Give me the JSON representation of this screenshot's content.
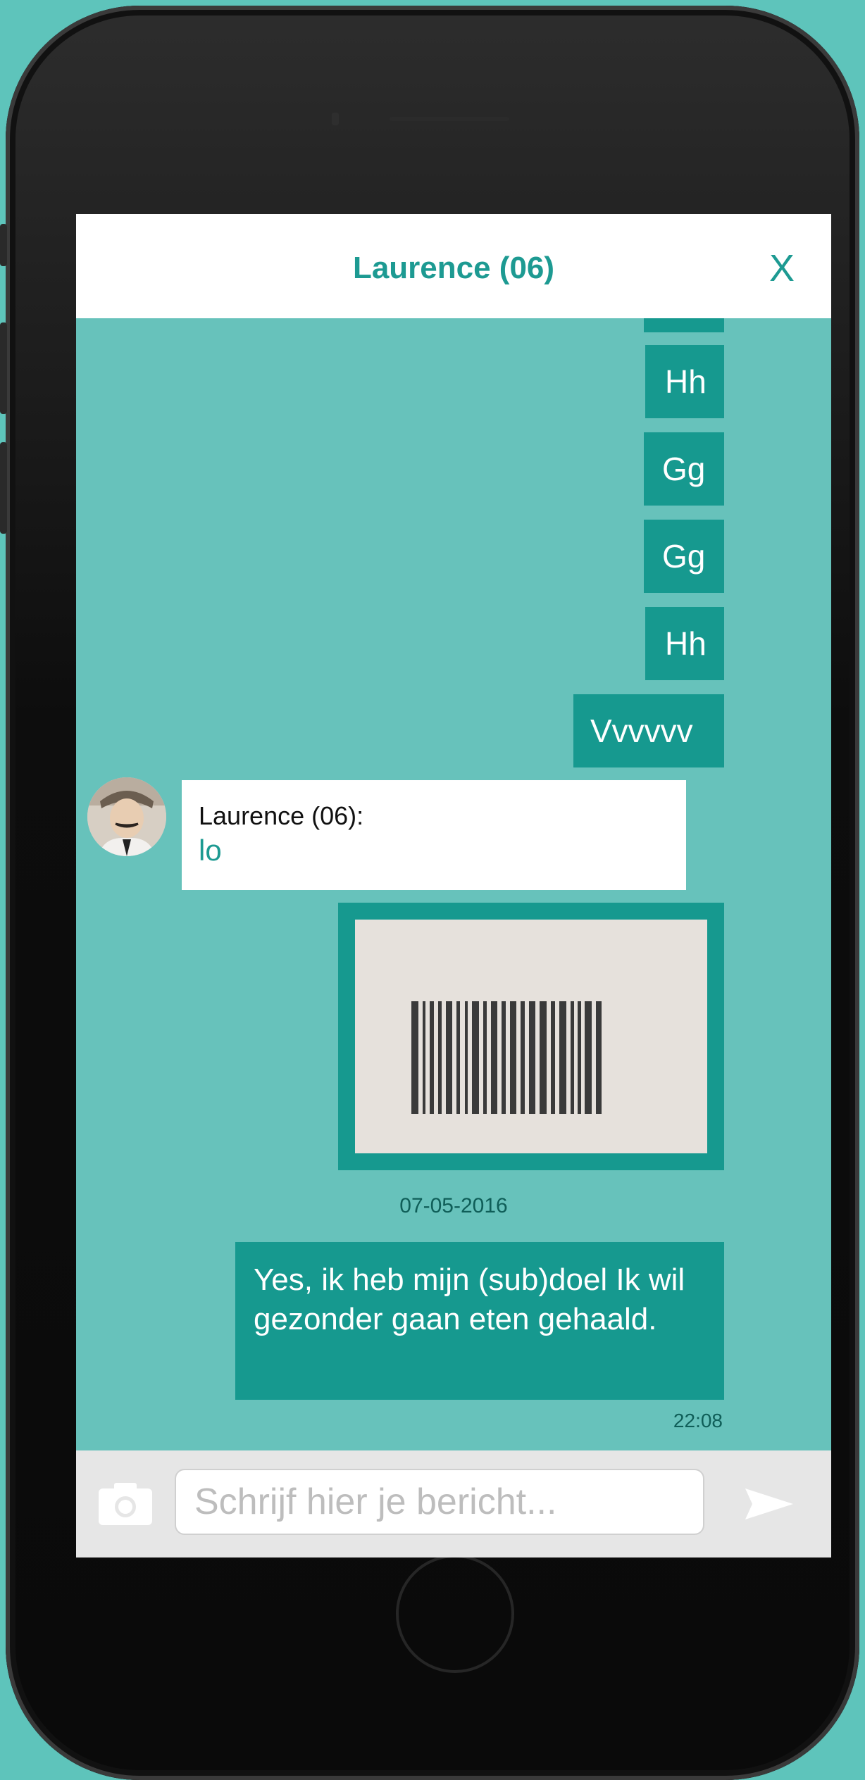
{
  "chat": {
    "title": "Laurence (06)",
    "close_label": "X"
  },
  "messages": {
    "out": [
      "Hh",
      "Gg",
      "Gg",
      "Hh",
      "Vvvvvv"
    ],
    "incoming_sender": "Laurence (06):",
    "incoming_text": "lo",
    "date_separator": "07-05-2016",
    "long_message": "Yes, ik heb mijn (sub)doel Ik wil gezonder gaan eten gehaald.",
    "long_message_time": "22:08"
  },
  "input": {
    "placeholder": "Schrijf hier je bericht..."
  },
  "icons": {
    "camera": "camera-icon",
    "send": "send-icon"
  },
  "colors": {
    "accent": "#1d9a92",
    "bubble": "#16998f",
    "background": "#67c2bb"
  }
}
